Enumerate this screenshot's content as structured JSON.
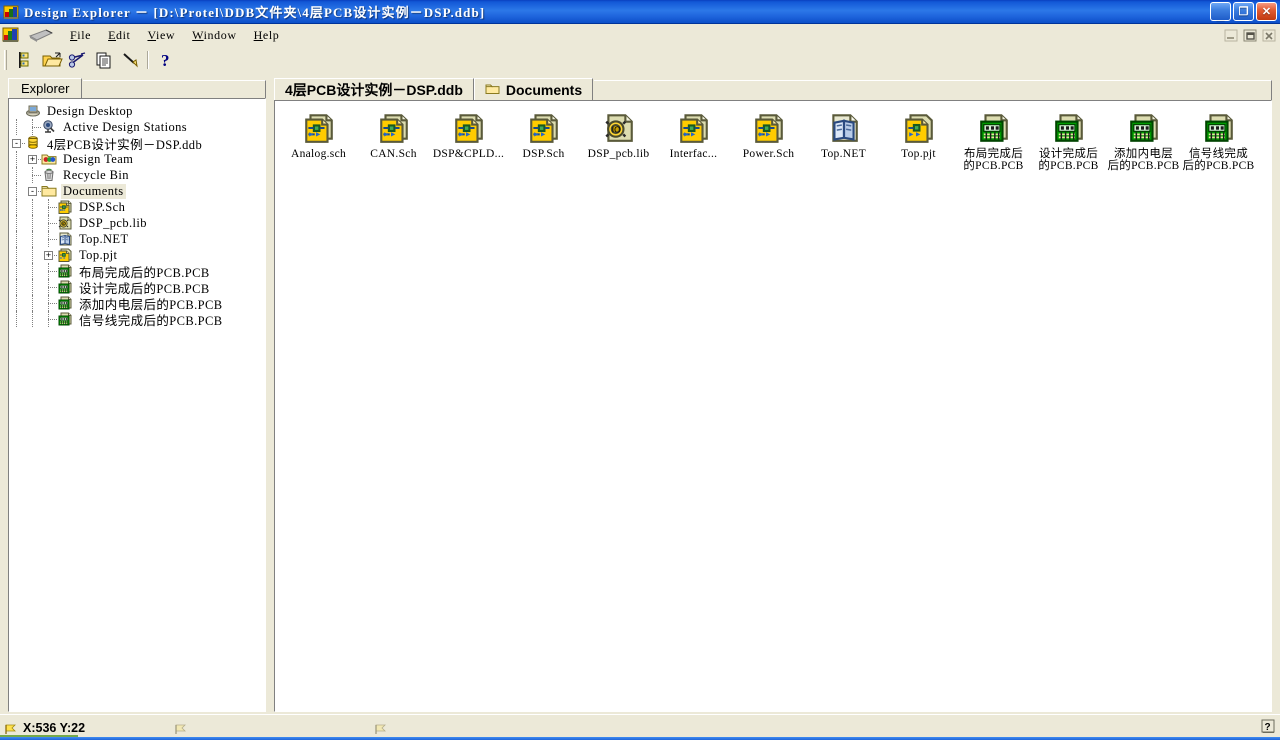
{
  "window": {
    "title": "Design Explorer － [D:\\Protel\\DDB文件夹\\4层PCB设计实例－DSP.ddb]",
    "app_icon": "protel-app-icon",
    "controls": {
      "minimize_label": "_",
      "restore_label": "❐",
      "close_label": "✕"
    },
    "mdi_controls": {
      "minimize": "mdi-minimize-icon",
      "restore": "mdi-restore-icon",
      "close": "mdi-close-icon"
    }
  },
  "menubar": {
    "app_icon": "protel-document-icon",
    "handle_icon": "gray-wedge-icon",
    "items": [
      {
        "label": "File",
        "mnemonic": "F"
      },
      {
        "label": "Edit",
        "mnemonic": "E"
      },
      {
        "label": "View",
        "mnemonic": "V"
      },
      {
        "label": "Window",
        "mnemonic": "W"
      },
      {
        "label": "Help",
        "mnemonic": "H"
      }
    ]
  },
  "toolbar": {
    "buttons": [
      {
        "name": "toggle-explorer-panel",
        "icon": "explorer-tree-icon"
      },
      {
        "name": "open-document",
        "icon": "open-folder-icon"
      },
      {
        "name": "cut",
        "icon": "scissors-icon"
      },
      {
        "name": "copy",
        "icon": "copy-pages-icon"
      },
      {
        "name": "paste",
        "icon": "paste-pencil-icon"
      },
      {
        "name": "whats-this-help",
        "icon": "question-mark-icon"
      }
    ]
  },
  "explorer_panel": {
    "tab_label": "Explorer",
    "tree": [
      {
        "label": "Design Desktop",
        "icon": "design-desktop-icon",
        "indent": 0,
        "expander": "",
        "selected": false
      },
      {
        "label": "Active Design Stations",
        "icon": "design-station-icon",
        "indent": 1,
        "expander": "",
        "selected": false
      },
      {
        "label": "4层PCB设计实例－DSP.ddb",
        "icon": "ddb-database-icon",
        "indent": 0,
        "expander": "-",
        "selected": false
      },
      {
        "label": "Design Team",
        "icon": "design-team-folder-icon",
        "indent": 1,
        "expander": "+",
        "selected": false
      },
      {
        "label": "Recycle Bin",
        "icon": "recycle-bin-icon",
        "indent": 1,
        "expander": "",
        "selected": false
      },
      {
        "label": "Documents",
        "icon": "folder-open-icon",
        "indent": 1,
        "expander": "-",
        "selected": true
      },
      {
        "label": "DSP.Sch",
        "icon": "schematic-doc-icon",
        "indent": 2,
        "expander": "",
        "selected": false
      },
      {
        "label": "DSP_pcb.lib",
        "icon": "pcb-library-icon",
        "indent": 2,
        "expander": "",
        "selected": false
      },
      {
        "label": "Top.NET",
        "icon": "netlist-doc-icon",
        "indent": 2,
        "expander": "",
        "selected": false
      },
      {
        "label": "Top.pjt",
        "icon": "schematic-project-icon",
        "indent": 2,
        "expander": "+",
        "selected": false
      },
      {
        "label": "布局完成后的PCB.PCB",
        "icon": "pcb-doc-icon",
        "indent": 2,
        "expander": "",
        "selected": false
      },
      {
        "label": "设计完成后的PCB.PCB",
        "icon": "pcb-doc-icon",
        "indent": 2,
        "expander": "",
        "selected": false
      },
      {
        "label": "添加内电层后的PCB.PCB",
        "icon": "pcb-doc-icon",
        "indent": 2,
        "expander": "",
        "selected": false
      },
      {
        "label": "信号线完成后的PCB.PCB",
        "icon": "pcb-doc-icon",
        "indent": 2,
        "expander": "",
        "selected": false
      }
    ]
  },
  "main_panel": {
    "tabs": [
      {
        "label": "4层PCB设计实例－DSP.ddb",
        "icon": "",
        "active": false
      },
      {
        "label": "Documents",
        "icon": "folder-icon",
        "active": true
      }
    ],
    "files": [
      {
        "label": "Analog.sch",
        "label2": "",
        "icon": "schematic-doc-icon"
      },
      {
        "label": "CAN.Sch",
        "label2": "",
        "icon": "schematic-doc-icon"
      },
      {
        "label": "DSP&CPLD...",
        "label2": "",
        "icon": "schematic-doc-icon"
      },
      {
        "label": "DSP.Sch",
        "label2": "",
        "icon": "schematic-doc-icon"
      },
      {
        "label": "DSP_pcb.lib",
        "label2": "",
        "icon": "pcb-library-icon"
      },
      {
        "label": "Interfac...",
        "label2": "",
        "icon": "schematic-doc-icon"
      },
      {
        "label": "Power.Sch",
        "label2": "",
        "icon": "schematic-doc-icon"
      },
      {
        "label": "Top.NET",
        "label2": "",
        "icon": "netlist-doc-icon"
      },
      {
        "label": "Top.pjt",
        "label2": "",
        "icon": "schematic-project-icon"
      },
      {
        "label": "布局完成后",
        "label2": "的PCB.PCB",
        "icon": "pcb-doc-icon"
      },
      {
        "label": "设计完成后",
        "label2": "的PCB.PCB",
        "icon": "pcb-doc-icon"
      },
      {
        "label": "添加内电层",
        "label2": "后的PCB.PCB",
        "icon": "pcb-doc-icon"
      },
      {
        "label": "信号线完成",
        "label2": "后的PCB.PCB",
        "icon": "pcb-doc-icon"
      }
    ]
  },
  "statusbar": {
    "coordinates": "X:536 Y:22",
    "cursor_icon": "yellow-flag-cursor-icon",
    "pane2_icon": "yellow-flag-cursor-icon",
    "pane3_icon": "yellow-flag-cursor-icon",
    "help_icon": "question-help-icon"
  },
  "colors": {
    "title_blue": "#2c78e8",
    "chrome": "#ece9d8",
    "panel_white": "#ffffff",
    "icon_yellow": "#ffcc00",
    "icon_paper": "#d8d8a8",
    "pcb_green": "#00a000",
    "border_dark": "#808080"
  }
}
